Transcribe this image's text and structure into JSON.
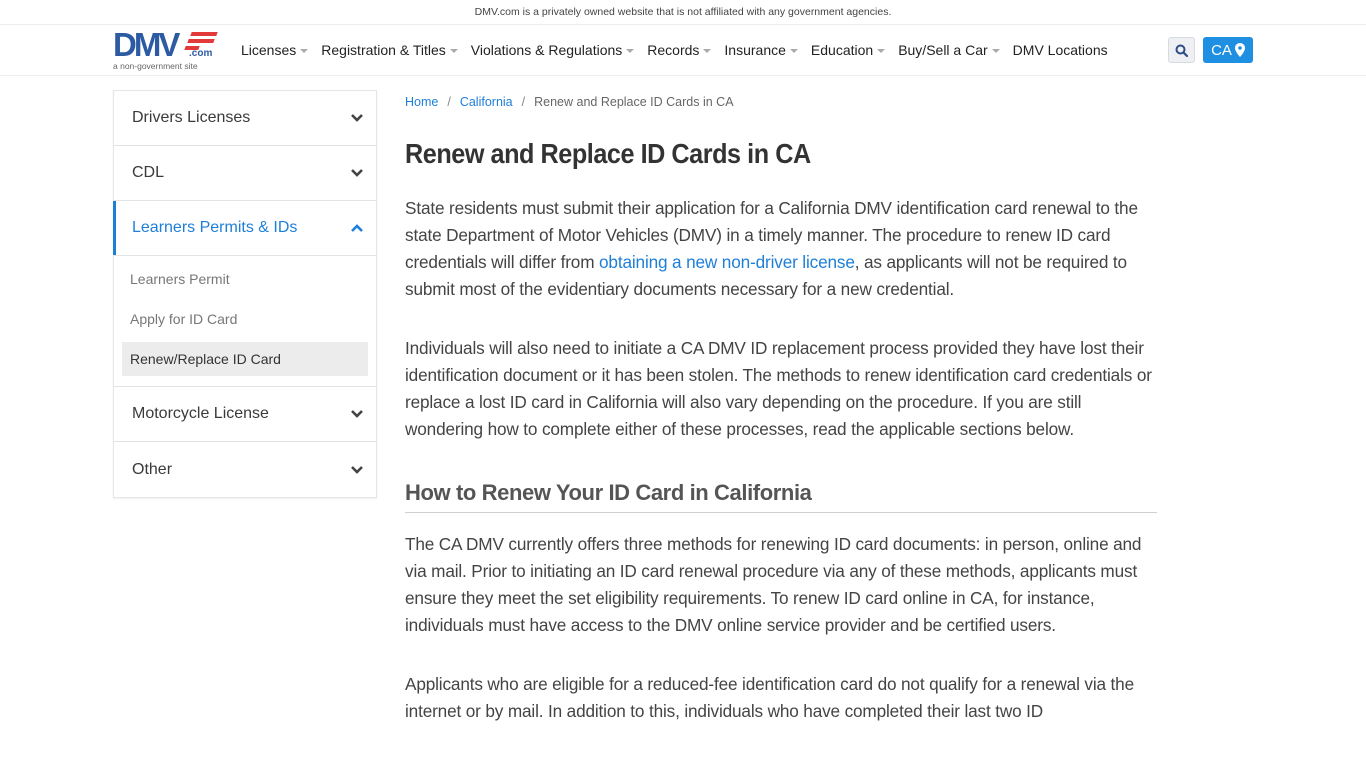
{
  "topbar": {
    "disclaimer": "DMV.com is a privately owned website that is not affiliated with any government agencies."
  },
  "header": {
    "logo": {
      "letters": "DMV",
      "suffix": ".com",
      "tagline": "a non-government site"
    },
    "nav": [
      {
        "label": "Licenses",
        "dropdown": true
      },
      {
        "label": "Registration & Titles",
        "dropdown": true
      },
      {
        "label": "Violations & Regulations",
        "dropdown": true
      },
      {
        "label": "Records",
        "dropdown": true
      },
      {
        "label": "Insurance",
        "dropdown": true
      },
      {
        "label": "Education",
        "dropdown": true
      },
      {
        "label": "Buy/Sell a Car",
        "dropdown": true
      },
      {
        "label": "DMV Locations",
        "dropdown": false
      }
    ],
    "search_icon": "search-icon",
    "state_button": {
      "label": "CA",
      "icon": "map-marker-icon"
    }
  },
  "sidebar": {
    "sections": [
      {
        "label": "Drivers Licenses",
        "expanded": false
      },
      {
        "label": "CDL",
        "expanded": false
      },
      {
        "label": "Learners Permits & IDs",
        "expanded": true,
        "items": [
          {
            "label": "Learners Permit",
            "current": false
          },
          {
            "label": "Apply for ID Card",
            "current": false
          },
          {
            "label": "Renew/Replace ID Card",
            "current": true
          }
        ]
      },
      {
        "label": "Motorcycle License",
        "expanded": false
      },
      {
        "label": "Other",
        "expanded": false
      }
    ]
  },
  "breadcrumb": {
    "home": "Home",
    "state": "California",
    "current": "Renew and Replace ID Cards in CA",
    "separator": "/"
  },
  "article": {
    "title": "Renew and Replace ID Cards in CA",
    "p1_before": "State residents must submit their application for a California DMV identification card renewal to the state Department of Motor Vehicles (DMV) in a timely manner. The procedure to renew ID card credentials will differ from ",
    "p1_link": "obtaining a new non-driver license",
    "p1_after": ", as applicants will not be required to submit most of the evidentiary documents necessary for a new credential.",
    "p2": "Individuals will also need to initiate a CA DMV ID replacement process provided they have lost their identification document or it has been stolen. The methods to renew identification card credentials or replace a lost ID card in California will also vary depending on the procedure. If you are still wondering how to complete either of these processes, read the applicable sections below.",
    "h2": "How to Renew Your ID Card in California",
    "p3": "The CA DMV currently offers three methods for renewing ID card documents: in person, online and via mail. Prior to initiating an ID card renewal procedure via any of these methods, applicants must ensure they meet the set eligibility requirements. To renew ID card online in CA, for instance, individuals must have access to the DMV online service provider and be certified users.",
    "p4": "Applicants who are eligible for a reduced-fee identification card do not qualify for a renewal via the internet or by mail. In addition to this, individuals who have completed their last two ID"
  },
  "colors": {
    "accent": "#1e7fd9",
    "brand_blue": "#2d5ba3",
    "brand_red": "#e23a3a",
    "button_blue": "#1e8fe1"
  }
}
